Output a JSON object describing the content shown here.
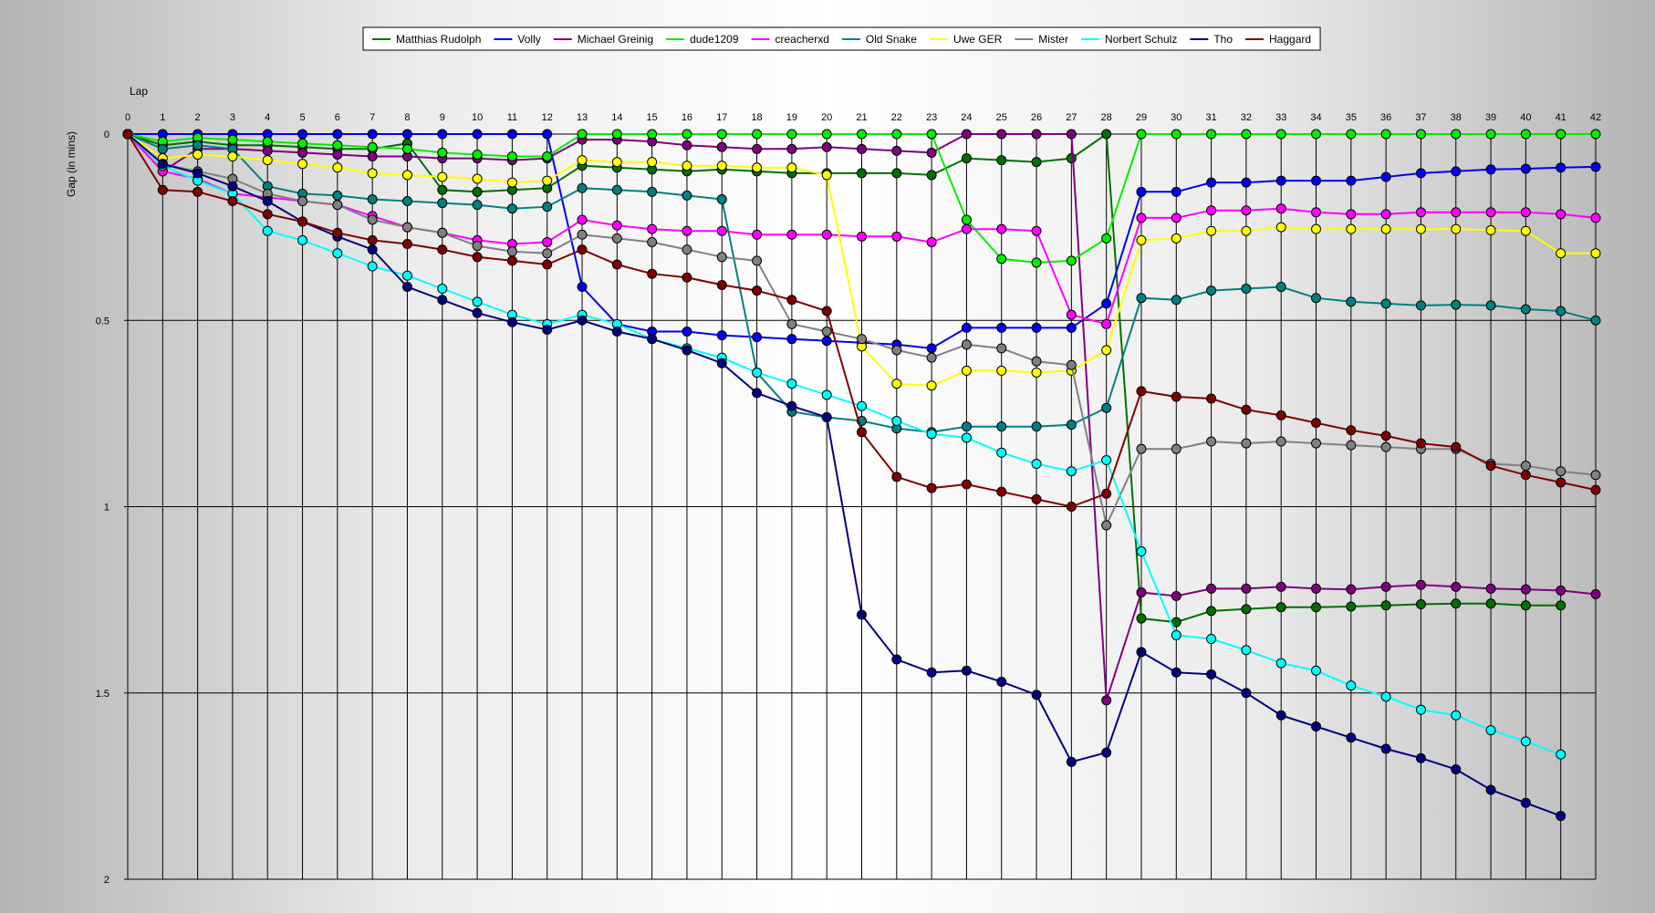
{
  "chart_data": {
    "type": "line",
    "x_axis_label": "Lap",
    "y_axis_label": "Gap (in mins)",
    "x": [
      0,
      1,
      2,
      3,
      4,
      5,
      6,
      7,
      8,
      9,
      10,
      11,
      12,
      13,
      14,
      15,
      16,
      17,
      18,
      19,
      20,
      21,
      22,
      23,
      24,
      25,
      26,
      27,
      28,
      29,
      30,
      31,
      32,
      33,
      34,
      35,
      36,
      37,
      38,
      39,
      40,
      41,
      42
    ],
    "xlim": [
      0,
      42
    ],
    "ylim": [
      0,
      2
    ],
    "y_inverted": true,
    "y_ticks": [
      0,
      0.5,
      1,
      1.5,
      2
    ],
    "y_tick_labels": [
      "0",
      "0.5",
      "1",
      "1.5",
      "2"
    ],
    "grid": "vertical at each lap, horizontal at 0.5 intervals",
    "legend_position": "top",
    "series": [
      {
        "name": "Matthias Rudolph",
        "color": "#007000",
        "values": [
          0,
          0.03,
          0.02,
          0.03,
          0.03,
          0.035,
          0.04,
          0.04,
          0.025,
          0.15,
          0.155,
          0.15,
          0.145,
          0.085,
          0.09,
          0.095,
          0.1,
          0.095,
          0.1,
          0.105,
          0.105,
          0.105,
          0.105,
          0.11,
          0.065,
          0.07,
          0.075,
          0.065,
          0,
          1.3,
          1.31,
          1.28,
          1.275,
          1.27,
          1.27,
          1.268,
          1.265,
          1.262,
          1.26,
          1.26,
          1.265,
          1.265,
          null
        ]
      },
      {
        "name": "Volly",
        "color": "#0000ee",
        "values": [
          0,
          0,
          0,
          0,
          0,
          0,
          0,
          0,
          0,
          0,
          0,
          0,
          0,
          0.41,
          0.51,
          0.53,
          0.53,
          0.54,
          0.545,
          0.55,
          0.555,
          0.56,
          0.565,
          0.575,
          0.52,
          0.52,
          0.52,
          0.52,
          0.455,
          0.155,
          0.155,
          0.13,
          0.13,
          0.125,
          0.125,
          0.125,
          0.115,
          0.105,
          0.1,
          0.095,
          0.093,
          0.09,
          0.088
        ]
      },
      {
        "name": "Michael Greinig",
        "color": "#800080",
        "values": [
          0,
          0.1,
          0.04,
          0.04,
          0.045,
          0.05,
          0.055,
          0.06,
          0.06,
          0.065,
          0.065,
          0.07,
          0.065,
          0.015,
          0.015,
          0.02,
          0.03,
          0.035,
          0.04,
          0.04,
          0.035,
          0.04,
          0.045,
          0.05,
          0,
          0,
          0,
          0,
          1.52,
          1.23,
          1.24,
          1.22,
          1.22,
          1.215,
          1.22,
          1.222,
          1.215,
          1.21,
          1.215,
          1.22,
          1.222,
          1.225,
          1.235
        ]
      },
      {
        "name": "dude1209",
        "color": "#00ee00",
        "values": [
          0,
          0.02,
          0.01,
          0.015,
          0.02,
          0.025,
          0.03,
          0.035,
          0.04,
          0.05,
          0.055,
          0.06,
          0.06,
          0,
          0,
          0,
          0,
          0,
          0,
          0,
          0,
          0,
          0,
          0,
          0.23,
          0.335,
          0.345,
          0.34,
          0.28,
          0,
          0,
          0,
          0,
          0,
          0,
          0,
          0,
          0,
          0,
          0,
          0,
          0,
          0
        ]
      },
      {
        "name": "creacherxd",
        "color": "#ff00ff",
        "values": [
          0,
          0.1,
          0.12,
          0.16,
          0.17,
          0.18,
          0.19,
          0.22,
          0.25,
          0.265,
          0.285,
          0.295,
          0.29,
          0.23,
          0.245,
          0.255,
          0.26,
          0.26,
          0.27,
          0.27,
          0.27,
          0.275,
          0.275,
          0.29,
          0.255,
          0.255,
          0.26,
          0.485,
          0.51,
          0.225,
          0.225,
          0.205,
          0.205,
          0.2,
          0.21,
          0.215,
          0.215,
          0.21,
          0.21,
          0.21,
          0.21,
          0.215,
          0.225
        ]
      },
      {
        "name": "Old Snake",
        "color": "#008080",
        "values": [
          0,
          0.04,
          0.03,
          0.04,
          0.14,
          0.16,
          0.165,
          0.175,
          0.18,
          0.185,
          0.19,
          0.2,
          0.195,
          0.145,
          0.15,
          0.155,
          0.165,
          0.175,
          0.64,
          0.745,
          0.76,
          0.77,
          0.79,
          0.8,
          0.785,
          0.785,
          0.785,
          0.78,
          0.735,
          0.44,
          0.445,
          0.42,
          0.415,
          0.41,
          0.44,
          0.45,
          0.455,
          0.46,
          0.458,
          0.46,
          0.47,
          0.475,
          0.5
        ]
      },
      {
        "name": "Uwe GER",
        "color": "#ffff00",
        "values": [
          0,
          0.065,
          0.055,
          0.06,
          0.07,
          0.08,
          0.09,
          0.105,
          0.11,
          0.115,
          0.12,
          0.13,
          0.125,
          0.07,
          0.075,
          0.075,
          0.085,
          0.085,
          0.09,
          0.09,
          0.11,
          0.57,
          0.67,
          0.675,
          0.635,
          0.635,
          0.64,
          0.635,
          0.58,
          0.285,
          0.28,
          0.26,
          0.26,
          0.25,
          0.255,
          0.255,
          0.255,
          0.255,
          0.255,
          0.258,
          0.26,
          0.32,
          0.32
        ]
      },
      {
        "name": "Mister",
        "color": "#808080",
        "values": [
          0,
          0.08,
          0.1,
          0.12,
          0.16,
          0.18,
          0.19,
          0.23,
          0.25,
          0.265,
          0.3,
          0.315,
          0.32,
          0.27,
          0.28,
          0.29,
          0.31,
          0.33,
          0.34,
          0.51,
          0.53,
          0.55,
          0.58,
          0.6,
          0.565,
          0.575,
          0.61,
          0.62,
          1.05,
          0.845,
          0.845,
          0.825,
          0.83,
          0.825,
          0.83,
          0.835,
          0.84,
          0.845,
          0.845,
          0.885,
          0.89,
          0.905,
          0.915
        ]
      },
      {
        "name": "Norbert Schulz",
        "color": "#00ffff",
        "values": [
          0,
          0.085,
          0.125,
          0.16,
          0.26,
          0.285,
          0.32,
          0.355,
          0.38,
          0.415,
          0.45,
          0.485,
          0.51,
          0.485,
          0.51,
          0.55,
          0.575,
          0.6,
          0.64,
          0.67,
          0.7,
          0.73,
          0.77,
          0.805,
          0.815,
          0.855,
          0.885,
          0.905,
          0.875,
          1.12,
          1.345,
          1.355,
          1.385,
          1.42,
          1.44,
          1.48,
          1.51,
          1.545,
          1.56,
          1.6,
          1.63,
          1.665,
          null
        ]
      },
      {
        "name": "Tho",
        "color": "#000080",
        "values": [
          0,
          0.08,
          0.105,
          0.14,
          0.18,
          0.235,
          0.275,
          0.31,
          0.41,
          0.445,
          0.48,
          0.505,
          0.525,
          0.5,
          0.53,
          0.55,
          0.58,
          0.615,
          0.695,
          0.73,
          0.76,
          1.29,
          1.41,
          1.445,
          1.44,
          1.47,
          1.505,
          1.685,
          1.66,
          1.39,
          1.445,
          1.45,
          1.5,
          1.56,
          1.59,
          1.62,
          1.65,
          1.675,
          1.705,
          1.76,
          1.795,
          1.83,
          null
        ]
      },
      {
        "name": "Haggard",
        "color": "#800000",
        "values": [
          0,
          0.15,
          0.155,
          0.18,
          0.215,
          0.235,
          0.265,
          0.285,
          0.295,
          0.31,
          0.33,
          0.34,
          0.35,
          0.31,
          0.35,
          0.375,
          0.385,
          0.405,
          0.42,
          0.445,
          0.475,
          0.8,
          0.92,
          0.95,
          0.94,
          0.96,
          0.98,
          1,
          0.965,
          0.69,
          0.705,
          0.71,
          0.74,
          0.755,
          0.775,
          0.795,
          0.81,
          0.83,
          0.84,
          0.89,
          0.915,
          0.935,
          0.955
        ]
      }
    ]
  }
}
